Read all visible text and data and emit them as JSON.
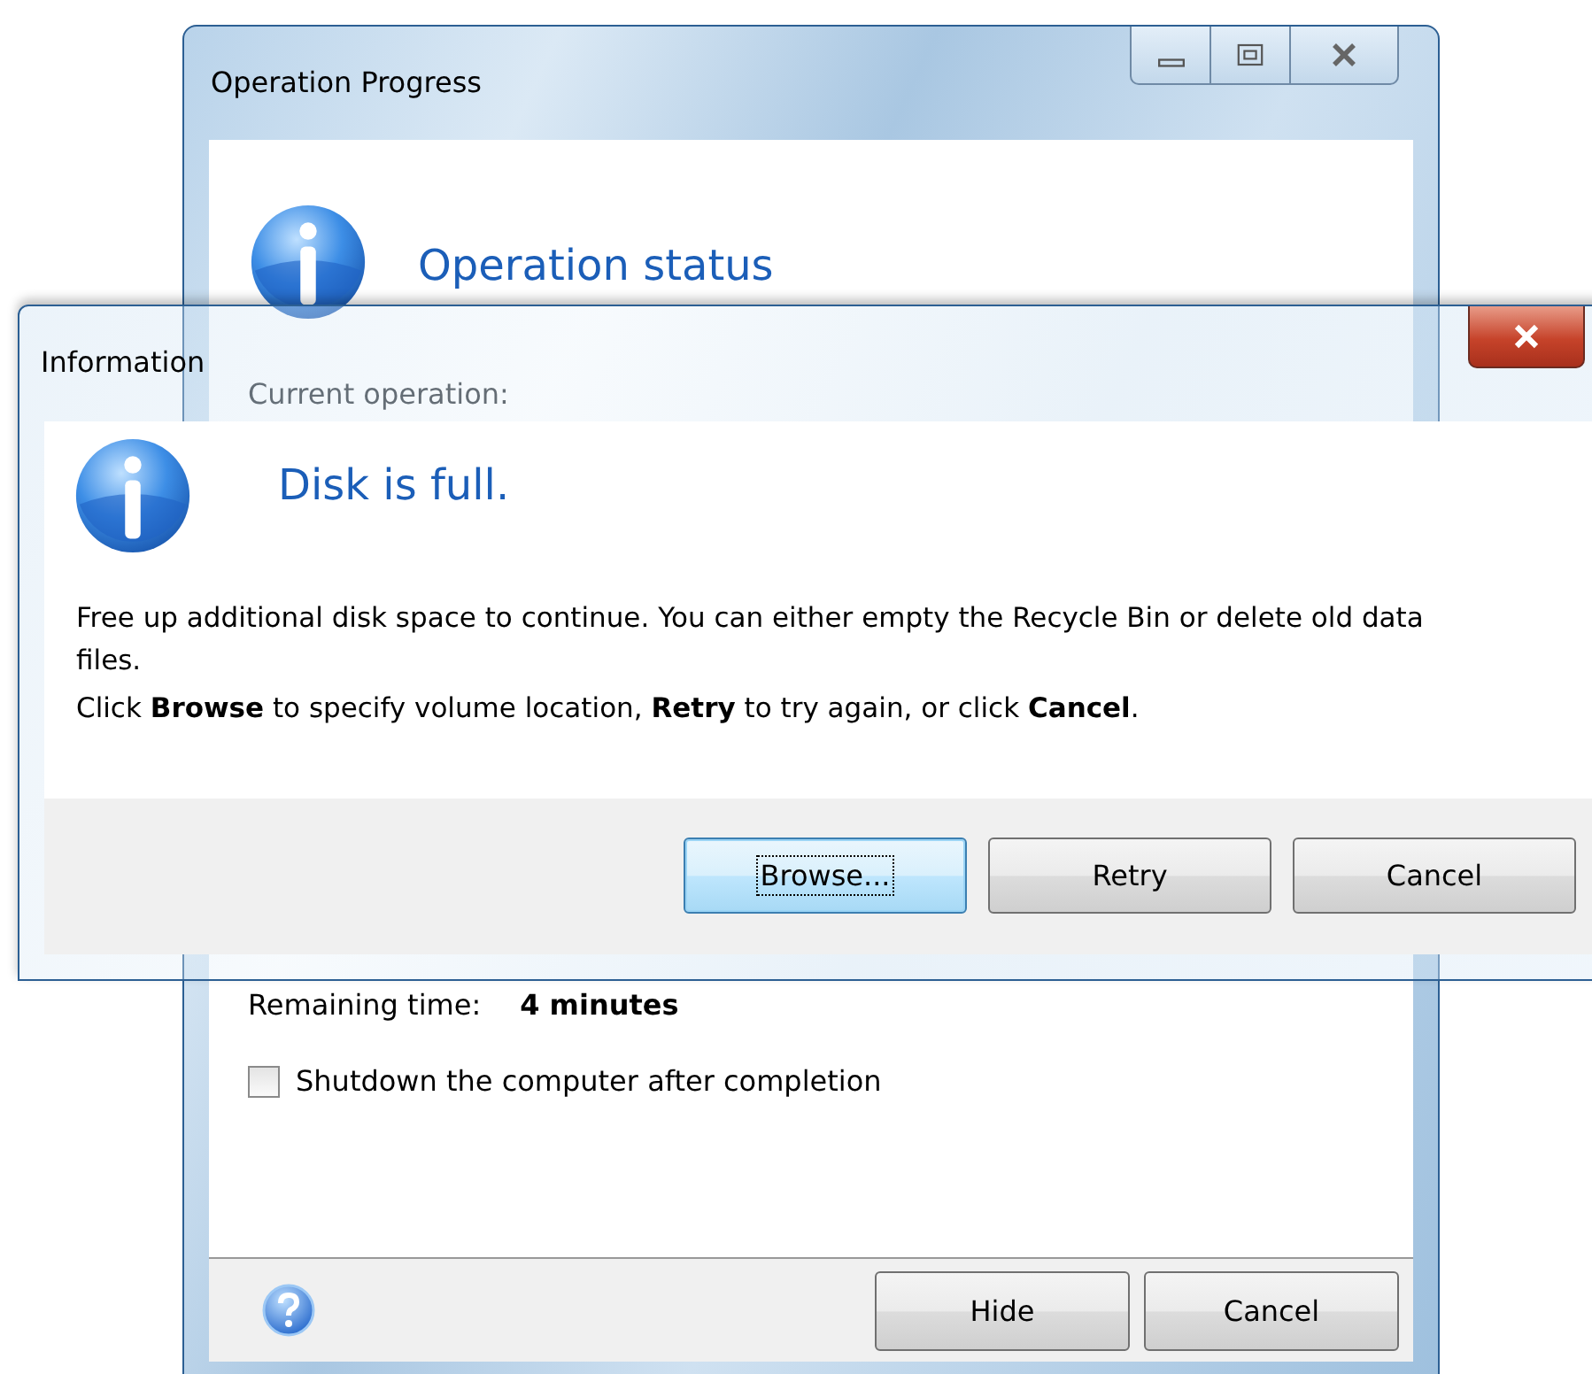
{
  "progress_window": {
    "title": "Operation Progress",
    "heading": "Operation status",
    "current_operation_label": "Current operation:",
    "remaining_label": "Remaining time:",
    "remaining_value": "4 minutes",
    "shutdown_checkbox": {
      "label": "Shutdown the computer after completion",
      "checked": false
    },
    "buttons": [
      {
        "label": "Hide",
        "focused": false
      },
      {
        "label": "Cancel",
        "focused": false
      }
    ]
  },
  "information_dialog": {
    "title": "Information",
    "heading": "Disk is full.",
    "message": [
      "Free up additional disk space to continue. You can either empty the Recycle Bin or delete old data files.",
      "Click **Browse** to specify volume location, **Retry** to try again, or click **Cancel**."
    ],
    "buttons": [
      {
        "label": "Browse...",
        "focused": true
      },
      {
        "label": "Retry",
        "focused": false
      },
      {
        "label": "Cancel",
        "focused": false
      }
    ]
  }
}
